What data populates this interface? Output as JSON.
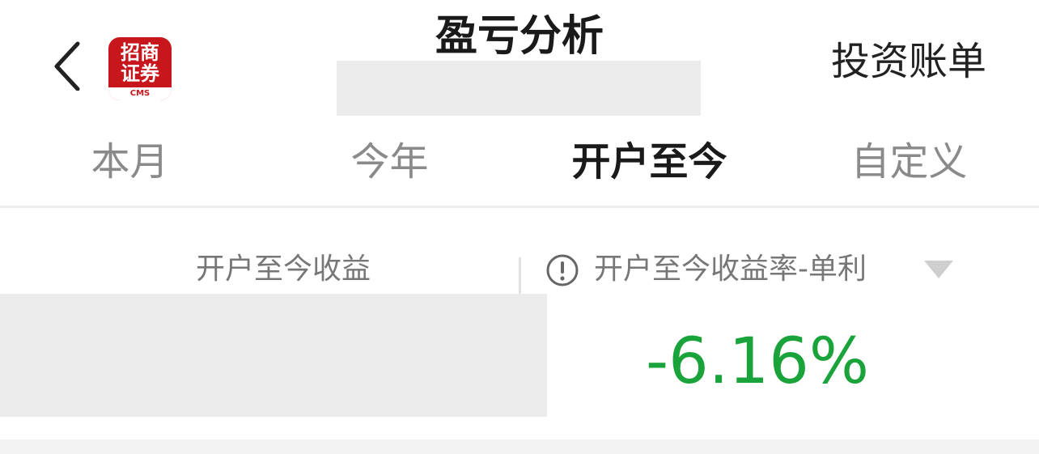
{
  "header": {
    "title": "盈亏分析",
    "bill_label": "投资账单",
    "logo": {
      "mark": "招商\n证券",
      "sub": "CMS",
      "color": "#c8161d"
    },
    "back_icon": "chevron-left-icon"
  },
  "tabs": [
    {
      "label": "本月",
      "active": false
    },
    {
      "label": "今年",
      "active": false
    },
    {
      "label": "开户至今",
      "active": true
    },
    {
      "label": "自定义",
      "active": false
    }
  ],
  "summary": {
    "profit_label": "开户至今收益",
    "rate_label": "开户至今收益率-单利",
    "rate_value": "-6.16%",
    "rate_color": "#1aa33a",
    "info_icon": "info-circle-icon",
    "dropdown_icon": "triangle-down-icon"
  }
}
